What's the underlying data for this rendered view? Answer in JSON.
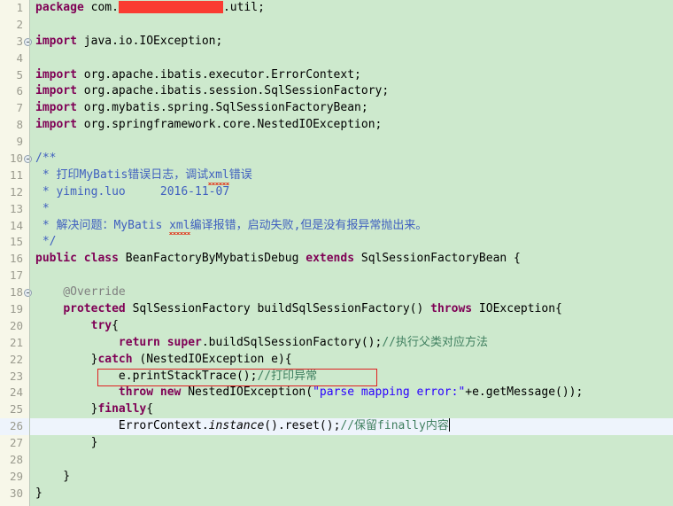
{
  "editor": {
    "language": "Java",
    "background_color": "#cde9cd",
    "gutter_color": "#f7f7e9",
    "current_line_color": "#eef4fc",
    "keyword_color": "#7f0055",
    "comment_color": "#3f7f5f",
    "javadoc_color": "#3f5fbf",
    "string_color": "#2a00ff",
    "annotation_color": "#808080",
    "redaction_color": "#fa3c32",
    "annotation_box_color": "#e02020",
    "total_lines": 30,
    "current_line": 26
  },
  "annotations": {
    "highlight_box_line": 23,
    "highlight_box_text": "e.printStackTrace();//打印异常",
    "redacted_package_segment": "com.██████████.util"
  },
  "lines": [
    {
      "n": "1",
      "fold": false,
      "tokens": [
        {
          "t": "package",
          "c": "kw"
        },
        {
          "t": " com.",
          "c": "plain"
        },
        {
          "t": "REDACTED",
          "c": "redact"
        },
        {
          "t": ".util;",
          "c": "plain"
        }
      ]
    },
    {
      "n": "2",
      "fold": false,
      "tokens": []
    },
    {
      "n": "3",
      "fold": true,
      "tokens": [
        {
          "t": "import",
          "c": "kw"
        },
        {
          "t": " java.io.IOException;",
          "c": "plain"
        }
      ]
    },
    {
      "n": "4",
      "fold": false,
      "tokens": []
    },
    {
      "n": "5",
      "fold": false,
      "tokens": [
        {
          "t": "import",
          "c": "kw"
        },
        {
          "t": " org.apache.ibatis.executor.ErrorContext;",
          "c": "plain"
        }
      ]
    },
    {
      "n": "6",
      "fold": false,
      "tokens": [
        {
          "t": "import",
          "c": "kw"
        },
        {
          "t": " org.apache.ibatis.session.SqlSessionFactory;",
          "c": "plain"
        }
      ]
    },
    {
      "n": "7",
      "fold": false,
      "tokens": [
        {
          "t": "import",
          "c": "kw"
        },
        {
          "t": " org.mybatis.spring.SqlSessionFactoryBean;",
          "c": "plain"
        }
      ]
    },
    {
      "n": "8",
      "fold": false,
      "tokens": [
        {
          "t": "import",
          "c": "kw"
        },
        {
          "t": " org.springframework.core.NestedIOException;",
          "c": "plain"
        }
      ]
    },
    {
      "n": "9",
      "fold": false,
      "tokens": []
    },
    {
      "n": "10",
      "fold": true,
      "tokens": [
        {
          "t": "/**",
          "c": "doc"
        }
      ]
    },
    {
      "n": "11",
      "fold": false,
      "tokens": [
        {
          "t": " * 打印MyBatis错误日志，调试",
          "c": "doc"
        },
        {
          "t": "xml",
          "c": "doc sq"
        },
        {
          "t": "错误",
          "c": "doc"
        }
      ]
    },
    {
      "n": "12",
      "fold": false,
      "tokens": [
        {
          "t": " * yiming.luo     2016-11-07",
          "c": "doc"
        }
      ]
    },
    {
      "n": "13",
      "fold": false,
      "tokens": [
        {
          "t": " *",
          "c": "doc"
        }
      ]
    },
    {
      "n": "14",
      "fold": false,
      "tokens": [
        {
          "t": " * 解决问题：MyBatis ",
          "c": "doc"
        },
        {
          "t": "xml",
          "c": "doc sq"
        },
        {
          "t": "编译报错，启动失败,但是没有报异常抛出来。",
          "c": "doc"
        }
      ]
    },
    {
      "n": "15",
      "fold": false,
      "tokens": [
        {
          "t": " */",
          "c": "doc"
        }
      ]
    },
    {
      "n": "16",
      "fold": false,
      "tokens": [
        {
          "t": "public class",
          "c": "kw"
        },
        {
          "t": " BeanFactoryByMybatisDebug ",
          "c": "plain"
        },
        {
          "t": "extends",
          "c": "kw"
        },
        {
          "t": " SqlSessionFactoryBean {",
          "c": "plain"
        }
      ]
    },
    {
      "n": "17",
      "fold": false,
      "tokens": []
    },
    {
      "n": "18",
      "fold": true,
      "tokens": [
        {
          "t": "    @Override",
          "c": "anno"
        }
      ]
    },
    {
      "n": "19",
      "fold": false,
      "tokens": [
        {
          "t": "    ",
          "c": "plain"
        },
        {
          "t": "protected",
          "c": "kw"
        },
        {
          "t": " SqlSessionFactory buildSqlSessionFactory() ",
          "c": "plain"
        },
        {
          "t": "throws",
          "c": "kw"
        },
        {
          "t": " IOException{",
          "c": "plain"
        }
      ]
    },
    {
      "n": "20",
      "fold": false,
      "tokens": [
        {
          "t": "        ",
          "c": "plain"
        },
        {
          "t": "try",
          "c": "kw"
        },
        {
          "t": "{",
          "c": "plain"
        }
      ]
    },
    {
      "n": "21",
      "fold": false,
      "tokens": [
        {
          "t": "            ",
          "c": "plain"
        },
        {
          "t": "return super",
          "c": "kw"
        },
        {
          "t": ".buildSqlSessionFactory();",
          "c": "plain"
        },
        {
          "t": "//执行父类对应方法",
          "c": "cmt"
        }
      ]
    },
    {
      "n": "22",
      "fold": false,
      "tokens": [
        {
          "t": "        }",
          "c": "plain"
        },
        {
          "t": "catch",
          "c": "kw"
        },
        {
          "t": " (NestedIOException e){",
          "c": "plain"
        }
      ]
    },
    {
      "n": "23",
      "fold": false,
      "tokens": [
        {
          "t": "            e.printStackTrace();",
          "c": "plain"
        },
        {
          "t": "//打印异常",
          "c": "cmt"
        }
      ]
    },
    {
      "n": "24",
      "fold": false,
      "tokens": [
        {
          "t": "            ",
          "c": "plain"
        },
        {
          "t": "throw new",
          "c": "kw"
        },
        {
          "t": " NestedIOException(",
          "c": "plain"
        },
        {
          "t": "\"parse mapping error:\"",
          "c": "str"
        },
        {
          "t": "+e.getMessage());",
          "c": "plain"
        }
      ]
    },
    {
      "n": "25",
      "fold": false,
      "tokens": [
        {
          "t": "        }",
          "c": "plain"
        },
        {
          "t": "finally",
          "c": "kw"
        },
        {
          "t": "{",
          "c": "plain"
        }
      ]
    },
    {
      "n": "26",
      "fold": false,
      "current": true,
      "tokens": [
        {
          "t": "            ErrorContext.",
          "c": "plain"
        },
        {
          "t": "instance",
          "c": "ital"
        },
        {
          "t": "().reset();",
          "c": "plain"
        },
        {
          "t": "//保留finally内容",
          "c": "cmt"
        },
        {
          "t": "CARET",
          "c": "caret"
        }
      ]
    },
    {
      "n": "27",
      "fold": false,
      "tokens": [
        {
          "t": "        }",
          "c": "plain"
        }
      ]
    },
    {
      "n": "28",
      "fold": false,
      "tokens": []
    },
    {
      "n": "29",
      "fold": false,
      "tokens": [
        {
          "t": "    }",
          "c": "plain"
        }
      ]
    },
    {
      "n": "30",
      "fold": false,
      "tokens": [
        {
          "t": "}",
          "c": "plain"
        }
      ]
    }
  ]
}
